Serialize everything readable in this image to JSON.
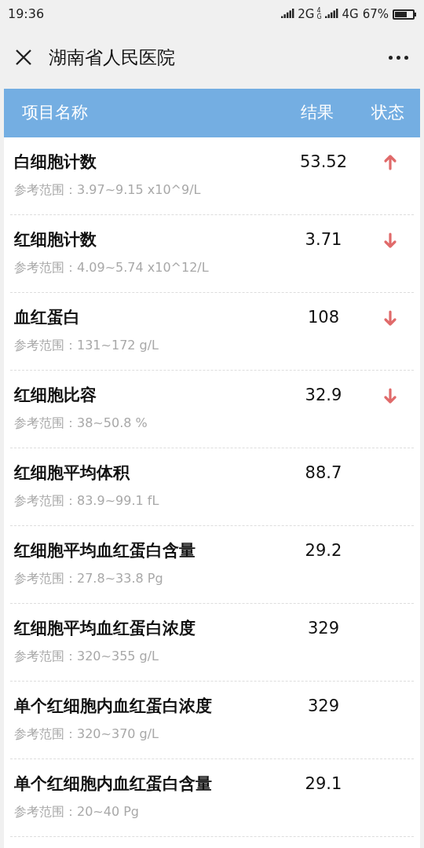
{
  "status_bar": {
    "time": "19:36",
    "network_1": "2G",
    "network_small": "4G",
    "network_2": "4G",
    "battery": "67%"
  },
  "header": {
    "title": "湖南省人民医院"
  },
  "table": {
    "columns": [
      "项目名称",
      "结果",
      "状态"
    ],
    "rows": [
      {
        "name": "白细胞计数",
        "range": "参考范围：3.97~9.15 x10^9/L",
        "result": "53.52",
        "kind": "high"
      },
      {
        "name": "红细胞计数",
        "range": "参考范围：4.09~5.74 x10^12/L",
        "result": "3.71",
        "kind": "low"
      },
      {
        "name": "血红蛋白",
        "range": "参考范围：131~172 g/L",
        "result": "108",
        "kind": "low"
      },
      {
        "name": "红细胞比容",
        "range": "参考范围：38~50.8 %",
        "result": "32.9",
        "kind": "low"
      },
      {
        "name": "红细胞平均体积",
        "range": "参考范围：83.9~99.1 fL",
        "result": "88.7",
        "kind": "normal"
      },
      {
        "name": "红细胞平均血红蛋白含量",
        "range": "参考范围：27.8~33.8 Pg",
        "result": "29.2",
        "kind": "normal"
      },
      {
        "name": "红细胞平均血红蛋白浓度",
        "range": "参考范围：320~355 g/L",
        "result": "329",
        "kind": "normal"
      },
      {
        "name": "单个红细胞内血红蛋白浓度",
        "range": "参考范围：320~370 g/L",
        "result": "329",
        "kind": "normal"
      },
      {
        "name": "单个红细胞内血红蛋白含量",
        "range": "参考范围：20~40 Pg",
        "result": "29.1",
        "kind": "normal"
      }
    ]
  }
}
